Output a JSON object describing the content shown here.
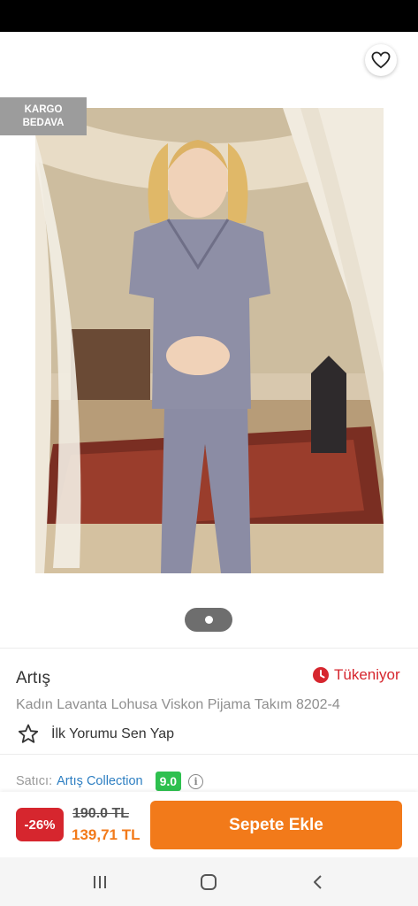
{
  "gallery": {
    "badge_line1": "KARGO",
    "badge_line2": "BEDAVA",
    "image_count": 1,
    "active_index": 0
  },
  "product": {
    "brand": "Artış",
    "name": "Kadın Lavanta Lohusa Viskon Pijama Takım 8202-4",
    "stock_status": "Tükeniyor",
    "review_prompt": "İlk Yorumu Sen Yap"
  },
  "seller": {
    "prefix": "Satıcı:",
    "name": "Artış Collection",
    "score": "9.0",
    "info_icon": "info-icon"
  },
  "pricing": {
    "discount": "-26%",
    "old_price": "190.0 TL",
    "new_price": "139,71 TL",
    "add_to_cart": "Sepete Ekle"
  },
  "colors": {
    "accent_orange": "#f27a1a",
    "alert_red": "#d6262e",
    "score_green": "#2ec04f",
    "seller_link_blue": "#2e7fc2",
    "badge_gray": "#9c9c9c"
  },
  "icons": {
    "back": "arrow-left-icon",
    "share": "share-icon",
    "favorite": "heart-outline-icon",
    "stock": "clock-icon",
    "review": "star-outline-icon",
    "nav_recents": "recents-icon",
    "nav_home": "home-icon",
    "nav_back": "nav-back-icon"
  }
}
